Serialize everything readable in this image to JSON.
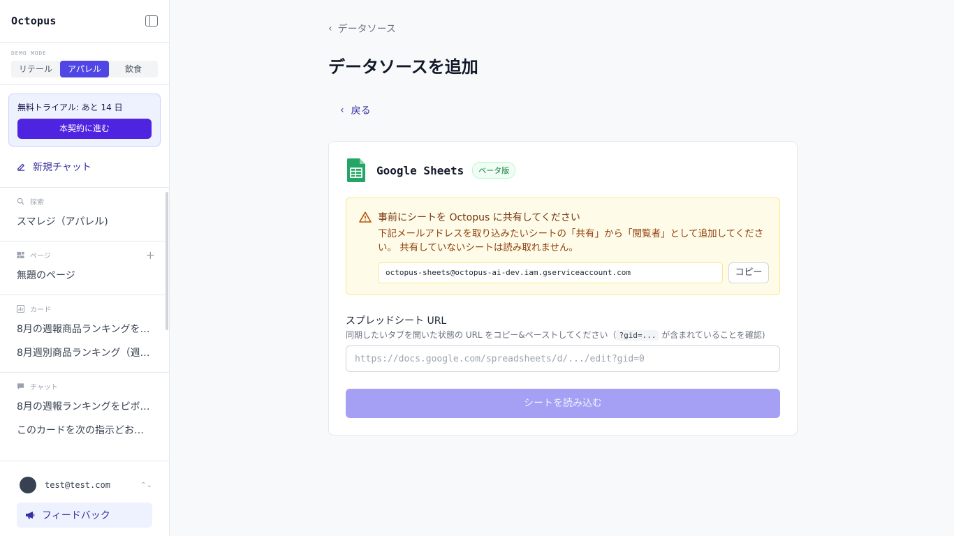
{
  "sidebar": {
    "brand": "Octopus",
    "demo_label": "DEMO MODE",
    "demo_modes": [
      "リテール",
      "アパレル",
      "飲食"
    ],
    "active_mode": "アパレル",
    "trial_text": "無料トライアル: あと 14 日",
    "trial_button": "本契約に進む",
    "new_chat": "新規チャット",
    "explore": {
      "title": "探索",
      "items": [
        "スマレジ（アパレル)"
      ]
    },
    "pages": {
      "title": "ページ",
      "items": [
        "無題のページ"
      ]
    },
    "cards": {
      "title": "カード",
      "items": [
        "8月の週報商品ランキングを…",
        "8月週別商品ランキング（週x…"
      ]
    },
    "chats": {
      "title": "チャット",
      "items": [
        "8月の週報ランキングをピボ…",
        "このカードを次の指示どおり…"
      ]
    },
    "user_email": "test@test.com",
    "feedback": "フィードバック"
  },
  "main": {
    "breadcrumb": "データソース",
    "title": "データソースを追加",
    "back": "戻る",
    "card": {
      "title": "Google Sheets",
      "badge": "ベータ版",
      "warning_title": "事前にシートを Octopus に共有してください",
      "warning_body": "下記メールアドレスを取り込みたいシートの「共有」から「閲覧者」として追加してください。 共有していないシートは読み取れません。",
      "service_email": "octopus-sheets@octopus-ai-dev.iam.gserviceaccount.com",
      "copy_label": "コピー",
      "url_label": "スプレッドシート URL",
      "url_help_before": "同期したいタブを開いた状態の URL をコピー&ペーストしてください（",
      "url_help_code": "?gid=...",
      "url_help_after": " が含まれていることを確認)",
      "url_placeholder": "https://docs.google.com/spreadsheets/d/.../edit?gid=0",
      "load_button": "シートを読み込む"
    }
  },
  "colors": {
    "accent": "#4f46e5",
    "button_disabled": "#a5a0f4",
    "warning_bg": "#fefce8"
  }
}
